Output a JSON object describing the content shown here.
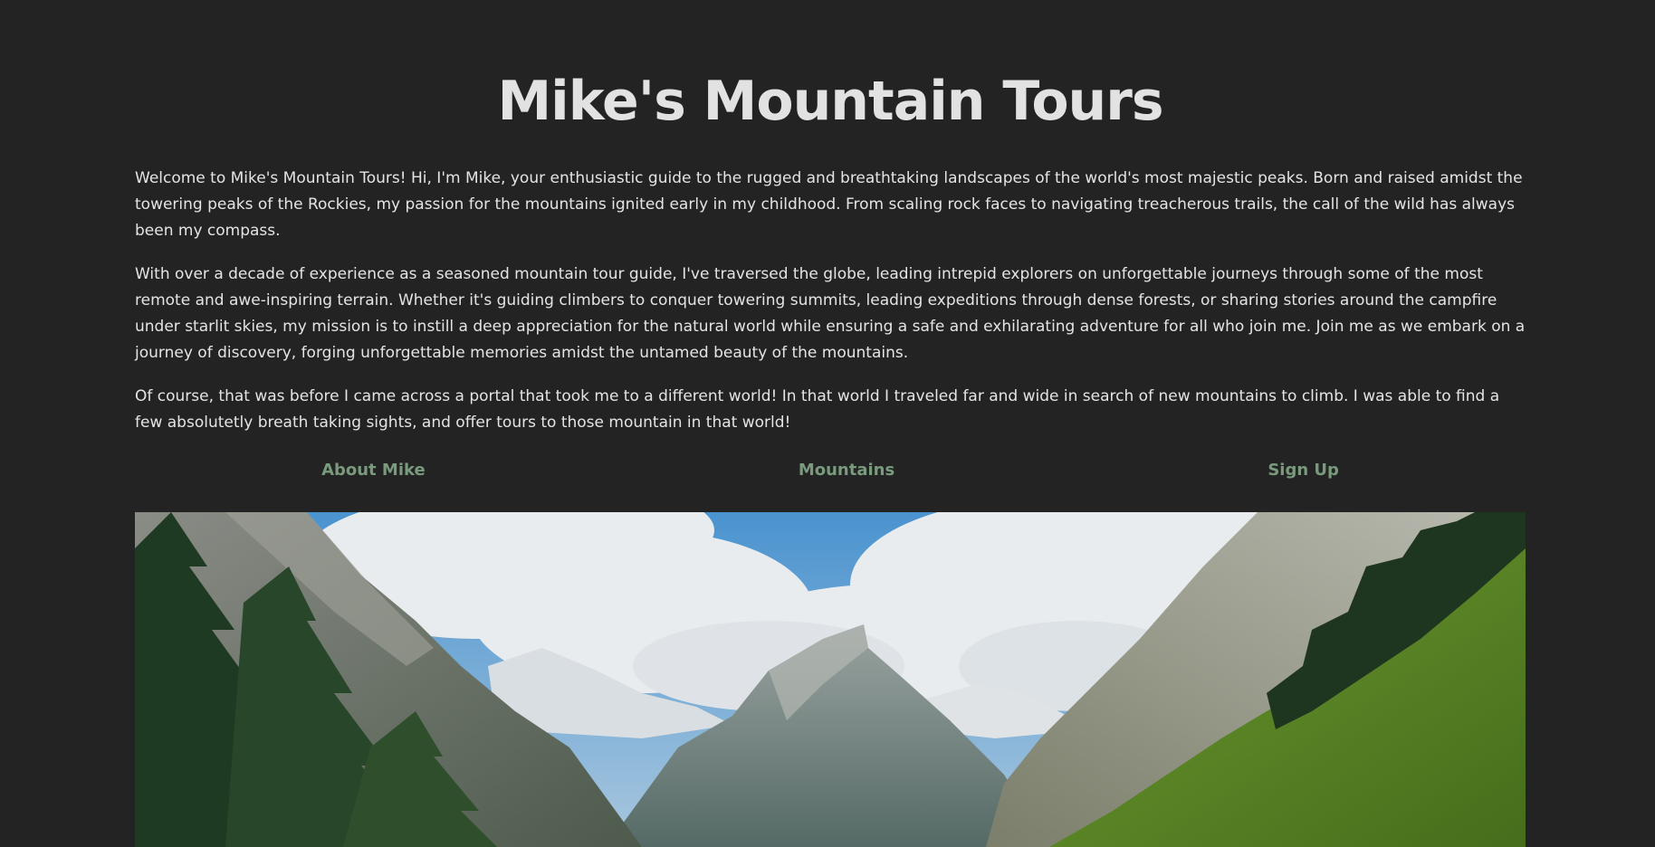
{
  "header": {
    "title": "Mike's Mountain Tours"
  },
  "intro": {
    "paragraphs": [
      "Welcome to Mike's Mountain Tours! Hi, I'm Mike, your enthusiastic guide to the rugged and breathtaking landscapes of the world's most majestic peaks. Born and raised amidst the towering peaks of the Rockies, my passion for the mountains ignited early in my childhood. From scaling rock faces to navigating treacherous trails, the call of the wild has always been my compass.",
      "With over a decade of experience as a seasoned mountain tour guide, I've traversed the globe, leading intrepid explorers on unforgettable journeys through some of the most remote and awe-inspiring terrain. Whether it's guiding climbers to conquer towering summits, leading expeditions through dense forests, or sharing stories around the campfire under starlit skies, my mission is to instill a deep appreciation for the natural world while ensuring a safe and exhilarating adventure for all who join me. Join me as we embark on a journey of discovery, forging unforgettable memories amidst the untamed beauty of the mountains.",
      "Of course, that was before I came across a portal that took me to a different world! In that world I traveled far and wide in search of new mountains to climb. I was able to find a few absolutetly breath taking sights, and offer tours to those mountain in that world!"
    ]
  },
  "nav": {
    "items": [
      {
        "label": "About Mike"
      },
      {
        "label": "Mountains"
      },
      {
        "label": "Sign Up"
      }
    ]
  },
  "colors": {
    "background": "#232323",
    "text": "#e4e4e4",
    "nav_link": "#7a9a7e"
  },
  "hero": {
    "subject": "mountain-valley-photo"
  }
}
